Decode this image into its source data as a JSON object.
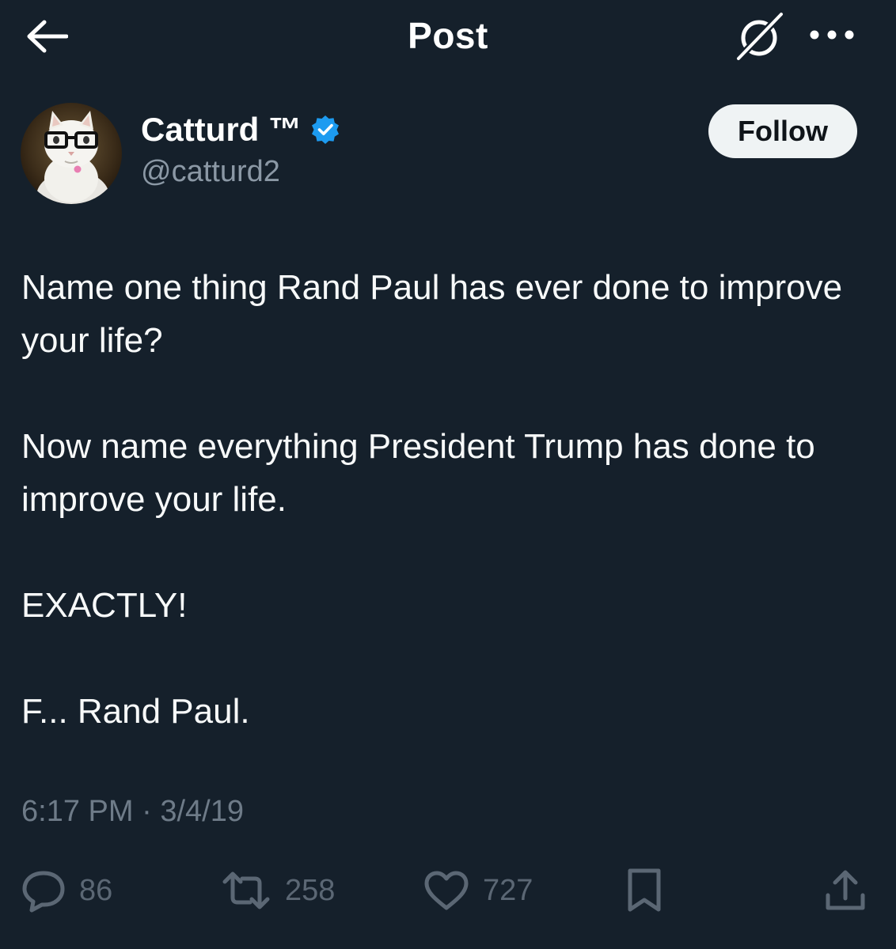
{
  "header": {
    "title": "Post",
    "back_icon": "arrow-left-icon",
    "grok_icon": "grok-icon",
    "more_icon": "more-horizontal-icon"
  },
  "author": {
    "display_name": "Catturd ™",
    "handle": "@catturd2",
    "verified": true,
    "verified_color": "#1d9bf0",
    "follow_label": "Follow"
  },
  "tweet": {
    "paragraphs": [
      "Name one thing Rand Paul has ever done to improve your life?",
      "Now name everything President Trump has done to improve your life.",
      "EXACTLY!",
      "F... Rand Paul."
    ],
    "time": "6:17 PM",
    "separator": "·",
    "date": "3/4/19"
  },
  "actions": {
    "replies": "86",
    "reposts": "258",
    "likes": "727"
  },
  "colors": {
    "background": "#15202b",
    "text": "#f7f9f9",
    "secondary": "#8b98a5",
    "accent": "#1d9bf0"
  }
}
